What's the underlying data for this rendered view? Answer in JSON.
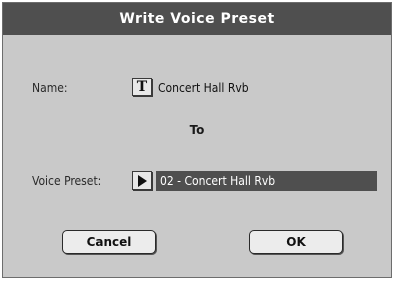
{
  "dialog": {
    "title": "Write Voice Preset",
    "name_label": "Name:",
    "name_icon": "T",
    "name_value": "Concert Hall Rvb",
    "to_label": "To",
    "voice_preset_label": "Voice Preset:",
    "voice_preset_value": "02 - Concert Hall Rvb",
    "cancel_label": "Cancel",
    "ok_label": "OK"
  }
}
